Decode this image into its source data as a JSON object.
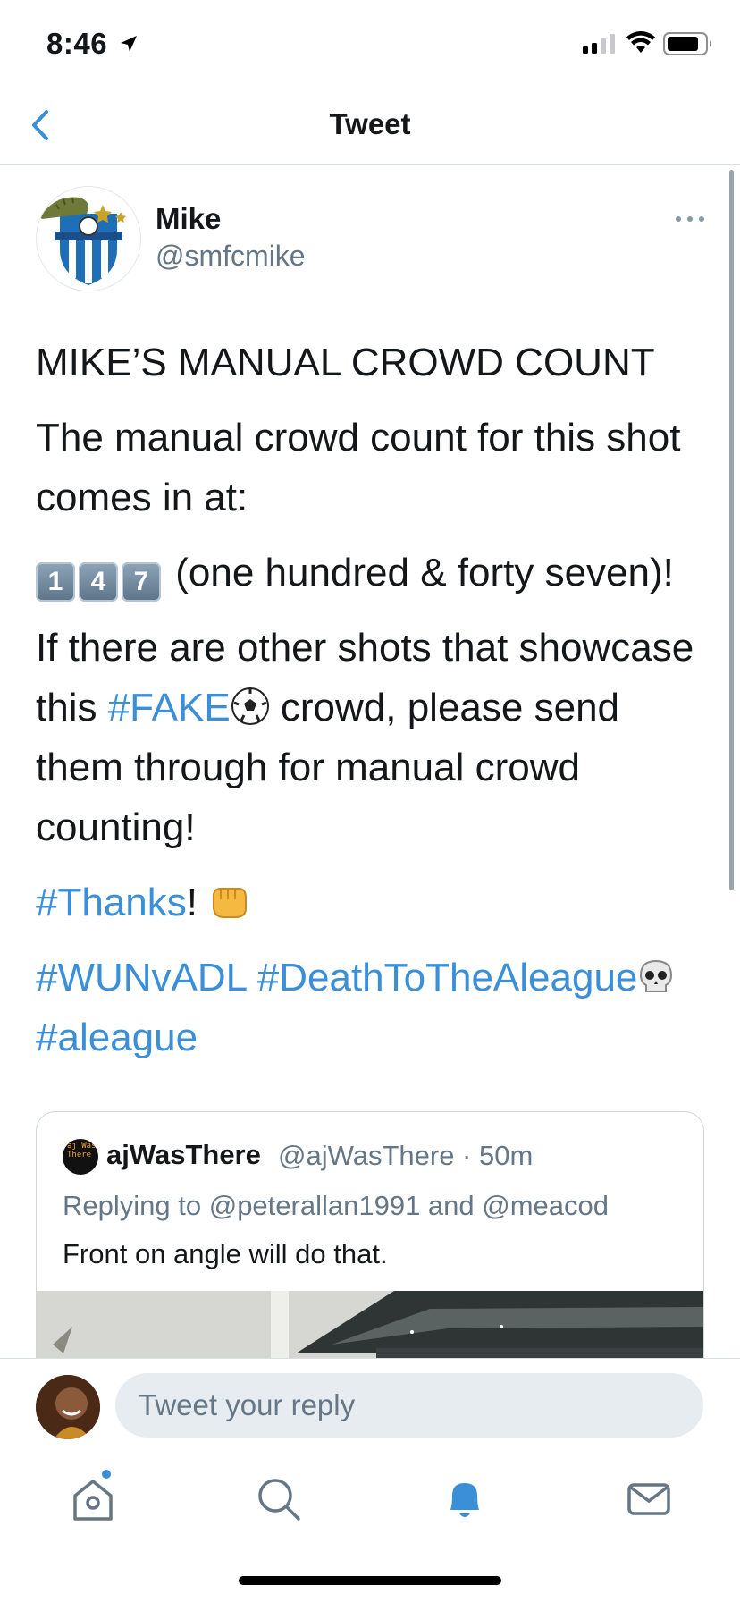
{
  "status_bar": {
    "time": "8:46"
  },
  "nav": {
    "title": "Tweet"
  },
  "tweet": {
    "author_name": "Mike",
    "author_handle": "@smfcmike",
    "heading": "MIKE’S MANUAL CROWD COUNT",
    "para1": "The manual crowd count for this shot comes in at:",
    "keycaps": [
      "1",
      "4",
      "7"
    ],
    "count_words": " (one hundred & forty seven)!",
    "para3_a": "If there are other shots that showcase this ",
    "hashtag_fake": "#FAKE",
    "para3_b": " crowd, please send them through for manual crowd counting!",
    "hashtag_thanks": "#Thanks",
    "thanks_suffix": "! ",
    "hashtag_wunvadl": "#WUNvADL",
    "hashtag_death": "#DeathToTheAleague",
    "hashtag_aleague": "#aleague"
  },
  "quoted_tweet": {
    "avatar_text": "aj Was There",
    "author_name": "ajWasThere",
    "meta": "@ajWasThere · 50m",
    "reply_prefix": "Replying to ",
    "mention1": "@peterallan1991",
    "reply_and": " and ",
    "mention2": "@meacod",
    "text": "Front on angle will do that."
  },
  "reply": {
    "placeholder": "Tweet your reply"
  },
  "tabs": [
    "home-icon",
    "search-icon",
    "notifications-icon",
    "messages-icon"
  ],
  "colors": {
    "accent": "#3a8fd8",
    "secondary_text": "#657786",
    "divider": "#d9dee2"
  }
}
